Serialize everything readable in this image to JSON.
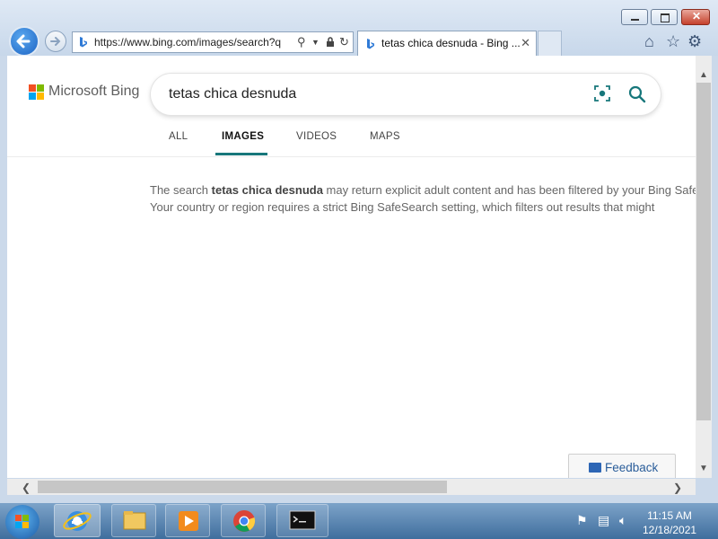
{
  "browser": {
    "url": "https://www.bing.com/images/search?q=",
    "tab_title": "tetas chica desnuda - Bing ...",
    "close_tab": "✕",
    "window_controls": [
      "minimize-icon",
      "maximize-icon",
      "close-icon"
    ],
    "toolbar_icons": [
      "home-icon",
      "favorites-star-icon",
      "settings-gear-icon"
    ]
  },
  "bing": {
    "logo_text": "Microsoft Bing",
    "query": "tetas chica desnuda",
    "tabs": [
      "ALL",
      "IMAGES",
      "VIDEOS",
      "MAPS"
    ],
    "active_tab": "IMAGES",
    "notice_line1_prefix": "The search ",
    "notice_query": "tetas chica desnuda",
    "notice_line1_suffix": " may return explicit adult content and has been filtered by your Bing SafeS",
    "notice_line2": "Your country or region requires a strict Bing SafeSearch setting, which filters out results that might",
    "feedback_label": "Feedback",
    "accent_color": "#17777b"
  },
  "taskbar": {
    "time": "11:15 AM",
    "date": "12/18/2021",
    "apps": [
      "internet-explorer",
      "file-explorer",
      "media-player",
      "chrome",
      "command-prompt"
    ]
  }
}
